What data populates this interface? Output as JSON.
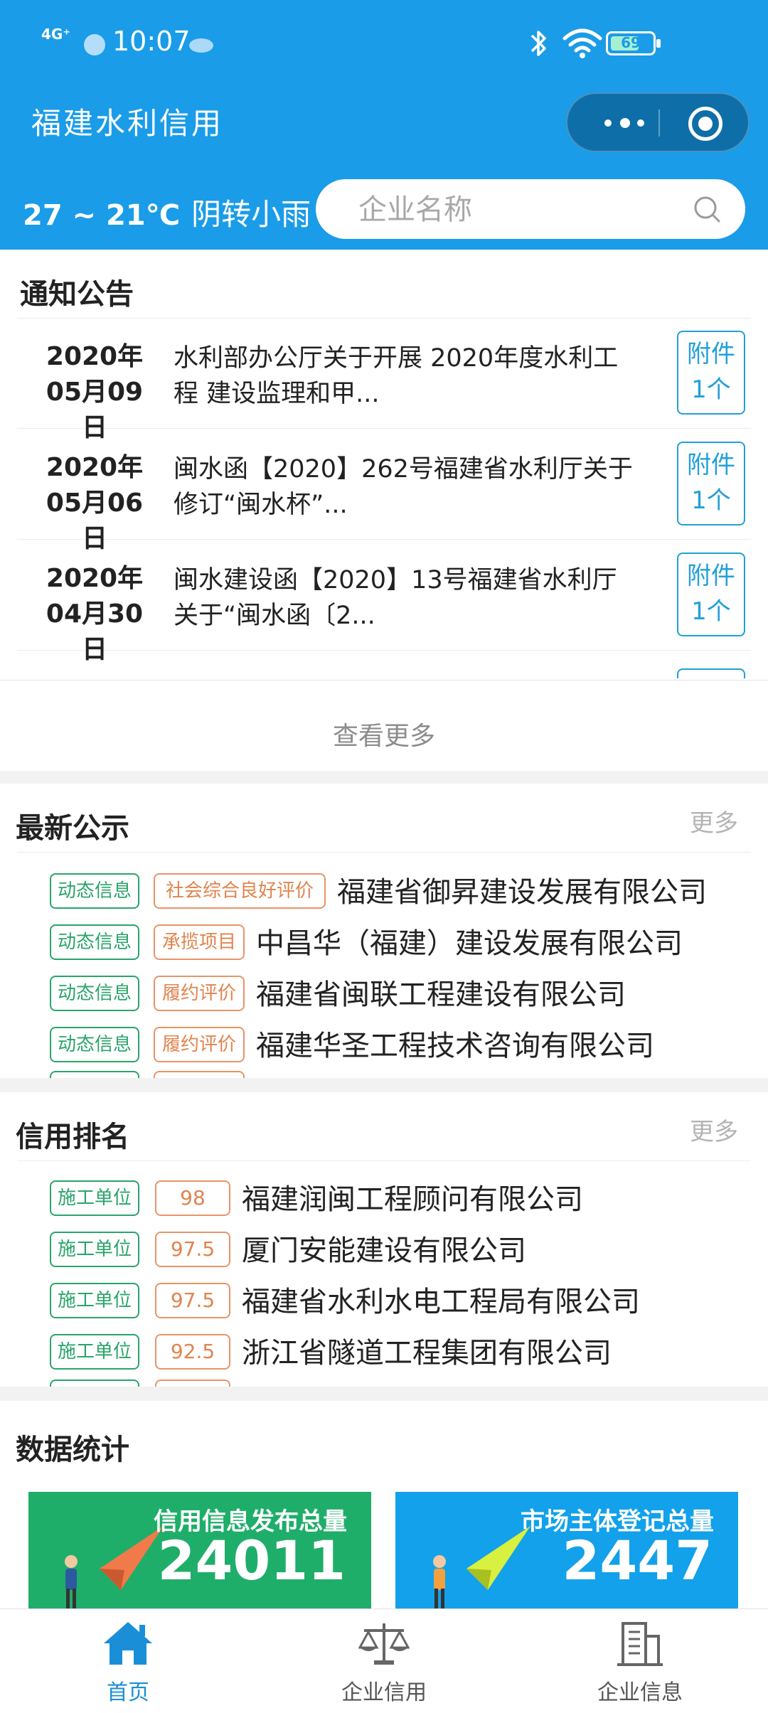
{
  "status_bar": {
    "network": "4G⁺",
    "time": "10:07",
    "battery": "69",
    "battery_level": 0.69
  },
  "header": {
    "title": "福建水利信用"
  },
  "weather": {
    "temp": "27 ~ 21℃",
    "desc": "阴转小雨"
  },
  "search": {
    "placeholder": "企业名称"
  },
  "notices": {
    "title": "通知公告",
    "items": [
      {
        "year": "2020年",
        "date": "05月09日",
        "text": "水利部办公厅关于开展 2020年度水利工\n程 建设监理和甲...",
        "attach_line1": "附件",
        "attach_line2": "1个"
      },
      {
        "year": "2020年",
        "date": "05月06日",
        "text": "闽水函【2020】262号福建省水利厅关于\n修订“闽水杯”...",
        "attach_line1": "附件",
        "attach_line2": "1个"
      },
      {
        "year": "2020年",
        "date": "04月30日",
        "text": "闽水建设函【2020】13号福建省水利厅\n关于“闽水函〔2...",
        "attach_line1": "附件",
        "attach_line2": "1个"
      }
    ],
    "view_more": "查看更多"
  },
  "announcements": {
    "title": "最新公示",
    "more": "更多",
    "items": [
      {
        "tag1": "动态信息",
        "tag2": "社会综合良好评价",
        "company": "福建省御昇建设发展有限公司"
      },
      {
        "tag1": "动态信息",
        "tag2": "承揽项目",
        "company": "中昌华（福建）建设发展有限公司"
      },
      {
        "tag1": "动态信息",
        "tag2": "履约评价",
        "company": "福建省闽联工程建设有限公司"
      },
      {
        "tag1": "动态信息",
        "tag2": "履约评价",
        "company": "福建华圣工程技术咨询有限公司"
      }
    ]
  },
  "ranking": {
    "title": "信用排名",
    "more": "更多",
    "items": [
      {
        "tag": "施工单位",
        "score": "98",
        "company": "福建润闽工程顾问有限公司"
      },
      {
        "tag": "施工单位",
        "score": "97.5",
        "company": "厦门安能建设有限公司"
      },
      {
        "tag": "施工单位",
        "score": "97.5",
        "company": "福建省水利水电工程局有限公司"
      },
      {
        "tag": "施工单位",
        "score": "92.5",
        "company": "浙江省隧道工程集团有限公司"
      }
    ]
  },
  "stats": {
    "title": "数据统计",
    "cards": [
      {
        "label": "信用信息发布总量",
        "value": "24011",
        "color": "#1fae6a"
      },
      {
        "label": "市场主体登记总量",
        "value": "2447",
        "color": "#12a1ea"
      }
    ]
  },
  "tabbar": {
    "items": [
      {
        "label": "首页",
        "icon": "home-icon"
      },
      {
        "label": "企业信用",
        "icon": "scales-icon"
      },
      {
        "label": "企业信息",
        "icon": "building-icon"
      }
    ],
    "active_color": "#1a8fd8"
  },
  "colors": {
    "primary": "#1a9ce8",
    "tag_green": "#2aa46a",
    "tag_orange": "#e0844e",
    "link_blue": "#22a0d8"
  }
}
